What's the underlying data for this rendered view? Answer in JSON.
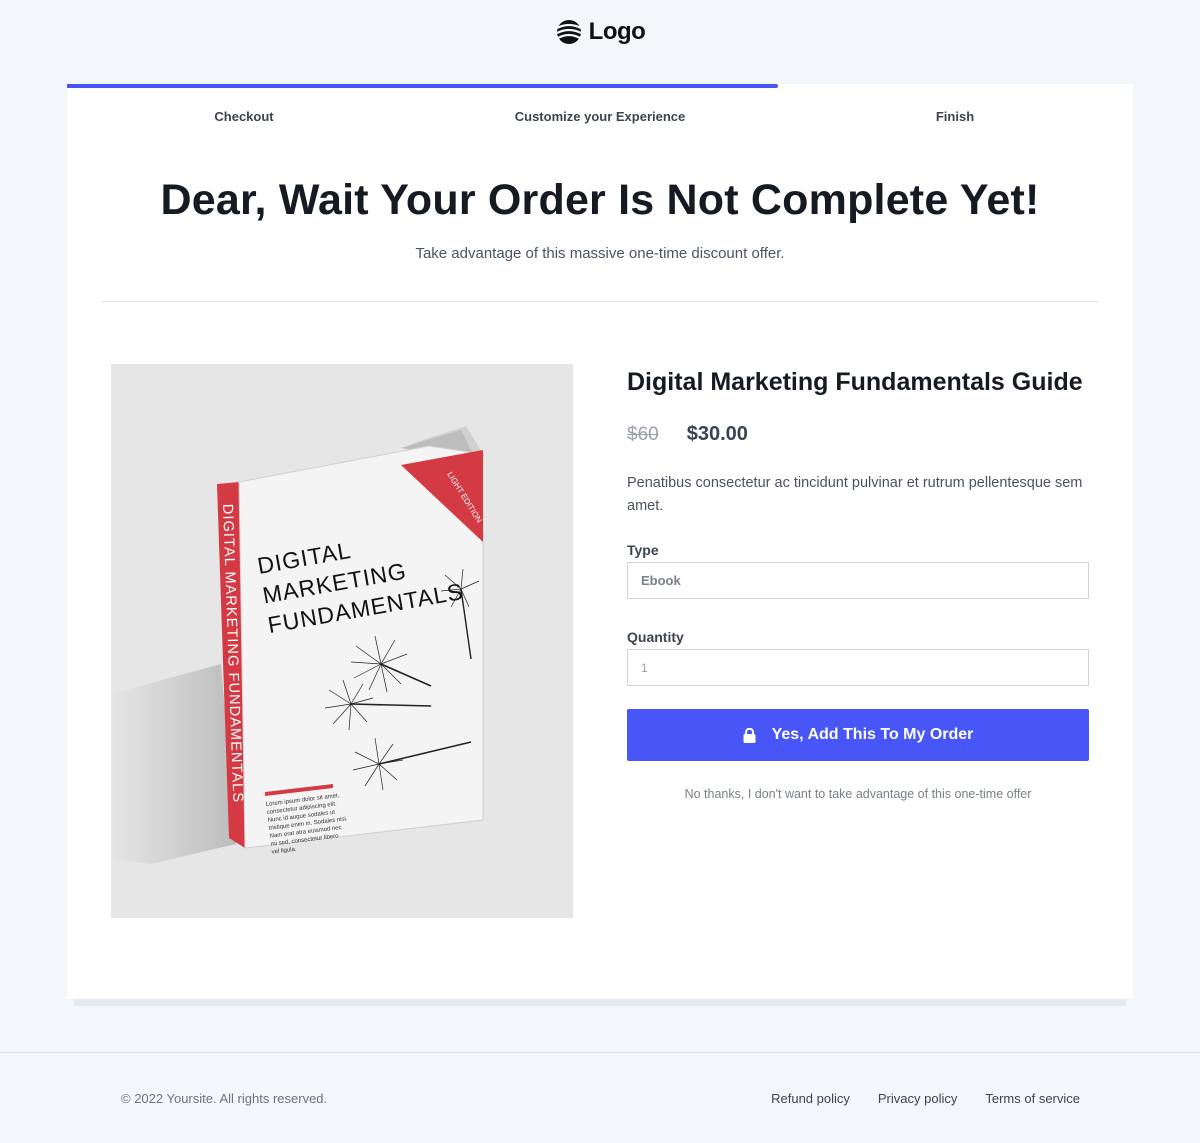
{
  "header": {
    "logo_text": "Logo"
  },
  "progress": {
    "fraction": 0.667
  },
  "steps": [
    {
      "label": "Checkout"
    },
    {
      "label": "Customize your Experience"
    },
    {
      "label": "Finish"
    }
  ],
  "hero": {
    "title": "Dear, Wait Your Order Is Not Complete Yet!",
    "subtitle": "Take advantage of this massive one-time discount offer."
  },
  "book": {
    "spine_text": "DIGITAL MARKETING FUNDAMENTALS",
    "cover_title_lines": [
      "DIGITAL",
      "MARKETING",
      "FUNDAMENTALS"
    ],
    "ribbon_text": "LIGHT EDITION",
    "blurb": "Lorem ipsum dolor sit amet, consectetur adipiscing elit. Nunc id augue sodales ut tristique enim in. Sodales nisi. Nam erat atra euismod nec mi sed, consectetur libero vel ligula."
  },
  "product": {
    "title": "Digital Marketing Fundamentals Guide",
    "old_price": "$60",
    "price": "$30.00",
    "description": "Penatibus consectetur ac tincidunt pulvinar et rutrum pellentesque sem amet.",
    "type_label": "Type",
    "type_value": "Ebook",
    "quantity_label": "Quantity",
    "quantity_value": "1",
    "cta_label": "Yes, Add This To My Order",
    "decline_label": "No thanks, I don't want to take advantage of this one-time offer"
  },
  "footer": {
    "copyright": "© 2022 Yoursite. All rights reserved.",
    "links": [
      "Refund policy",
      "Privacy policy",
      "Terms of service"
    ]
  },
  "colors": {
    "accent": "#4855f7",
    "ribbon": "#d9363e"
  },
  "icons": {
    "logo": "wave-circle-icon",
    "cta": "lock-icon"
  }
}
